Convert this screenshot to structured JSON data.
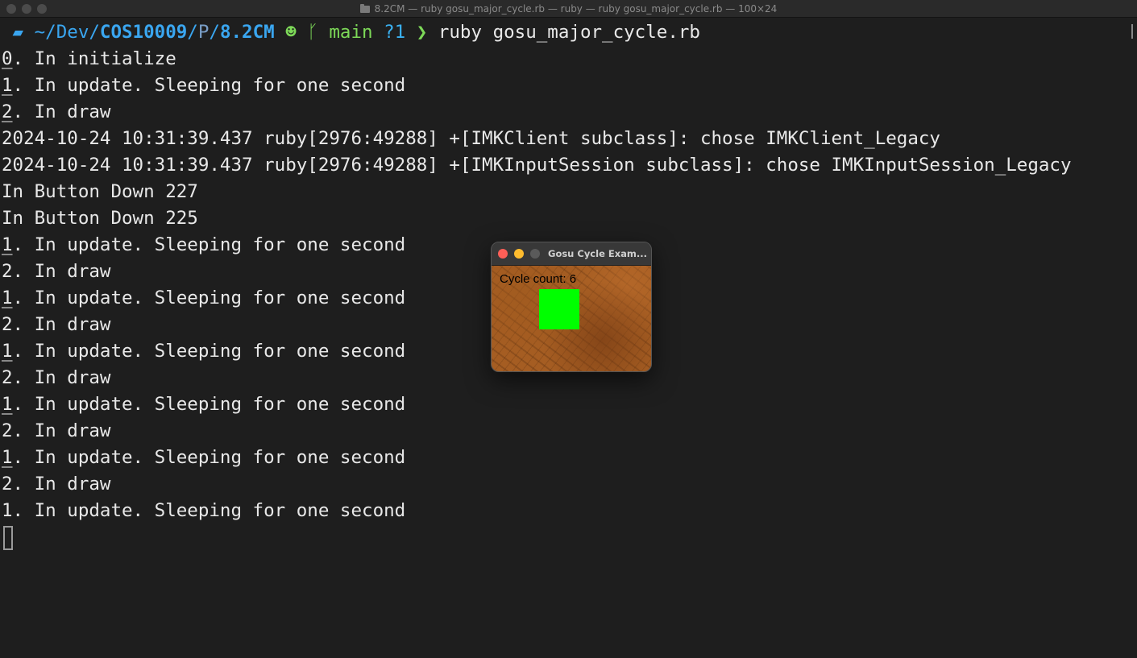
{
  "window": {
    "title": "8.2CM — ruby gosu_major_cycle.rb — ruby — ruby gosu_major_cycle.rb — 100×24"
  },
  "prompt": {
    "tilde": "~/",
    "dev": "Dev/",
    "course": "COS10009",
    "sep": "/",
    "p": "P",
    "sep2": "/",
    "folder": "8.2CM",
    "branch": "main",
    "status": "?1",
    "chevron": "❯",
    "command": "ruby gosu_major_cycle.rb"
  },
  "output": [
    {
      "n": "0",
      "text": ". In initialize"
    },
    {
      "n": "1",
      "text": ". In update. Sleeping for one second"
    },
    {
      "n": "2",
      "text": ". In draw"
    },
    {
      "n": "",
      "text": "2024-10-24 10:31:39.437 ruby[2976:49288] +[IMKClient subclass]: chose IMKClient_Legacy"
    },
    {
      "n": "",
      "text": "2024-10-24 10:31:39.437 ruby[2976:49288] +[IMKInputSession subclass]: chose IMKInputSession_Legacy"
    },
    {
      "n": "",
      "text": "In Button Down 227"
    },
    {
      "n": "",
      "text": "In Button Down 225"
    },
    {
      "n": "1",
      "text": ". In update. Sleeping for one second"
    },
    {
      "n": "2",
      "text": ". In draw"
    },
    {
      "n": "1",
      "text": ". In update. Sleeping for one second"
    },
    {
      "n": "2",
      "text": ". In draw"
    },
    {
      "n": "1",
      "text": ". In update. Sleeping for one second"
    },
    {
      "n": "2",
      "text": ". In draw"
    },
    {
      "n": "1",
      "text": ". In update. Sleeping for one second"
    },
    {
      "n": "2",
      "text": ". In draw"
    },
    {
      "n": "1",
      "text": ". In update. Sleeping for one second"
    },
    {
      "n": "2",
      "text": ". In draw"
    },
    {
      "n": "1",
      "text": ". In update. Sleeping for one second"
    }
  ],
  "gosu": {
    "title": "Gosu Cycle Exam...",
    "cycle_text": "Cycle count: 6",
    "square_color": "#00ff00"
  },
  "colors": {
    "background": "#1e1e1e",
    "path": "#3aa6f0",
    "git": "#7dd958"
  },
  "icons": [
    "apple-icon",
    "folder-icon",
    "github-icon",
    "git-branch-icon"
  ]
}
